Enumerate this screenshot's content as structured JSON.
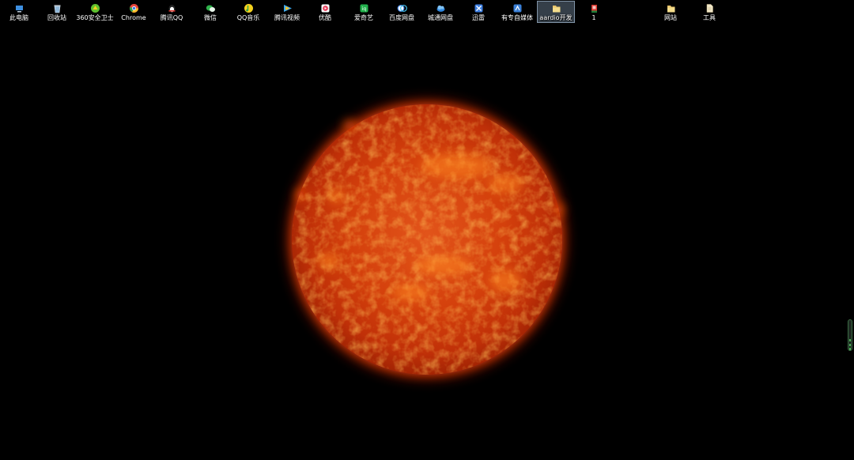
{
  "desktop": {
    "icons": [
      {
        "label": "此电脑",
        "icon": "computer-icon",
        "color": "#3d8fe0"
      },
      {
        "label": "回收站",
        "icon": "recycle-bin-icon",
        "color": "#8fb7d9"
      },
      {
        "label": "360安全卫士",
        "icon": "shield-360-icon",
        "color": "#5fc12f"
      },
      {
        "label": "Chrome",
        "icon": "chrome-icon",
        "color": "#e8453c"
      },
      {
        "label": "腾讯QQ",
        "icon": "qq-penguin-icon",
        "color": "#d9352c"
      },
      {
        "label": "微信",
        "icon": "wechat-icon",
        "color": "#2fb24b"
      },
      {
        "label": "QQ音乐",
        "icon": "qq-music-icon",
        "color": "#f4d11e"
      },
      {
        "label": "腾讯视频",
        "icon": "tencent-video-icon",
        "color": "#3aa8f0"
      },
      {
        "label": "优酷",
        "icon": "youku-icon",
        "color": "#e7415e"
      },
      {
        "label": "爱奇艺",
        "icon": "iqiyi-icon",
        "color": "#22b14c"
      },
      {
        "label": "百度网盘",
        "icon": "baidu-netdisk-icon",
        "color": "#4d8ef0"
      },
      {
        "label": "城通网盘",
        "icon": "ctfile-cloud-icon",
        "color": "#2e86de"
      },
      {
        "label": "迅雷",
        "icon": "thunder-icon",
        "color": "#3b7de0"
      },
      {
        "label": "有专自媒体",
        "icon": "media-tool-icon",
        "color": "#3a7fd6"
      },
      {
        "label": "aardio开发",
        "icon": "folder-icon",
        "color": "#e8c46a"
      },
      {
        "label": "1",
        "icon": "shortcut-1-icon",
        "color": "#d9352c"
      },
      {
        "label": "网站",
        "icon": "folder-icon",
        "color": "#e8c46a"
      },
      {
        "label": "工具",
        "icon": "document-icon",
        "color": "#f0e6c8"
      }
    ],
    "selected_index": 14
  },
  "wallpaper": {
    "subject": "sun",
    "colors": {
      "core": "#f06a14",
      "mid": "#d23a08",
      "edge": "#8f1a02",
      "background": "#000000"
    }
  }
}
